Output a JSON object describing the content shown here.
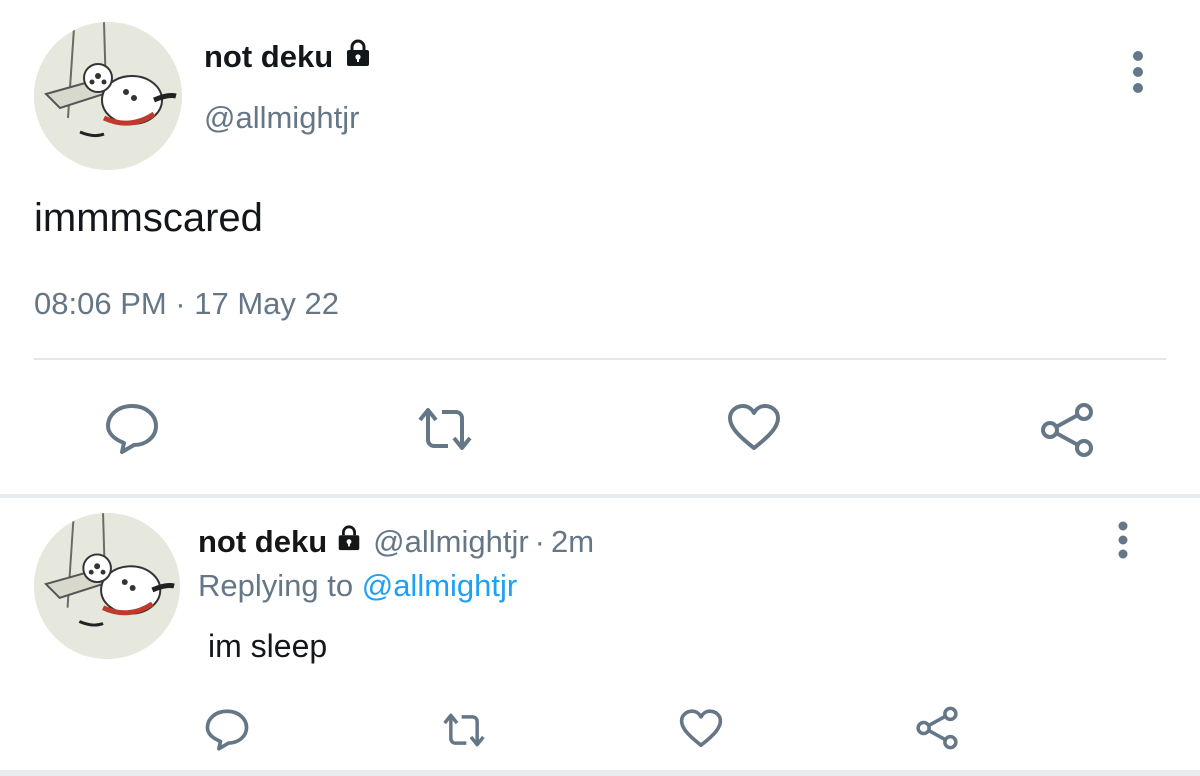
{
  "main_tweet": {
    "display_name": "not deku",
    "handle": "@allmightjr",
    "text": "immmscared",
    "timestamp": "08:06 PM · 17 May 22",
    "icons": {
      "lock": "lock-icon",
      "more": "more-vertical-icon",
      "reply": "reply-bubble-icon",
      "retweet": "retweet-icon",
      "like": "heart-icon",
      "share": "share-icon"
    }
  },
  "reply_tweet": {
    "display_name": "not deku",
    "handle": "@allmightjr",
    "separator": "·",
    "time": "2m",
    "replying_prefix": "Replying to",
    "replying_handle": "@allmightjr",
    "text": "im sleep"
  },
  "colors": {
    "text": "#14171a",
    "secondary": "#657786",
    "link": "#1da1f2",
    "divider": "#e1e6ea",
    "icon": "#657786"
  }
}
